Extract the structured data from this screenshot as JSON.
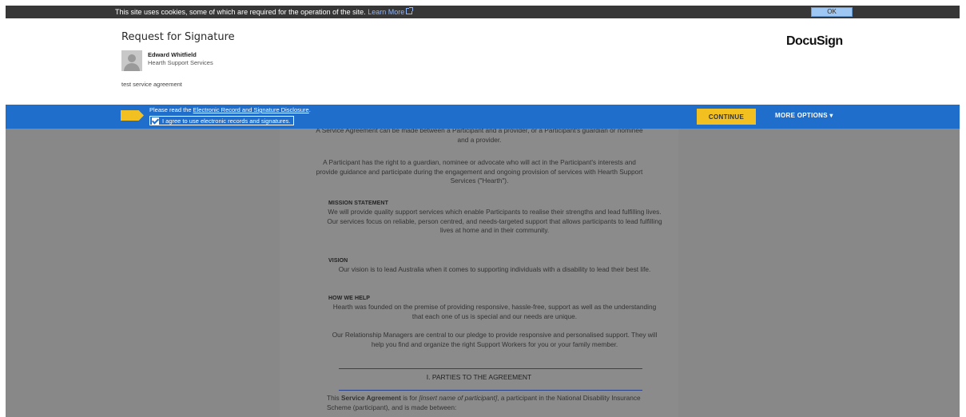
{
  "cookie_banner": {
    "text": "This site uses cookies, some of which are required for the operation of the site.",
    "link": "Learn More",
    "ok": "OK"
  },
  "header": {
    "title": "Request for Signature",
    "sender_name": "Edward Whitfield",
    "sender_company": "Hearth Support Services",
    "message": "test service agreement",
    "logo": "DocuSign"
  },
  "action_bar": {
    "read_prefix": "Please read the",
    "disclosure_link": "Electronic Record and Signature Disclosure",
    "read_suffix": ".",
    "agree_label": "I agree to use electronic records and signatures.",
    "agree_checked": true,
    "continue": "CONTINUE",
    "more_options": "MORE OPTIONS ▾"
  },
  "document": {
    "intro": "A Service Agreement can be made between a Participant and a provider, or a Participant's guardian or nominee and a provider.",
    "rights": "A Participant has the right to a guardian, nominee or advocate who will act in the Participant's interests and provide guidance and participate during the engagement and ongoing provision of services with Hearth Support Services (\"Hearth\").",
    "mission_heading": "MISSION STATEMENT",
    "mission_text": "We will provide quality support services which enable Participants to realise their strengths and lead fulfilling lives. Our services focus on reliable, person centred, and needs-targeted support that allows participants to lead fulfilling lives at home and in their community.",
    "vision_heading": "VISION",
    "vision_text": "Our vision is to lead Australia when it comes to supporting individuals with a disability to lead their best life.",
    "help_heading": "HOW WE HELP",
    "help_text": "Hearth was founded on the premise of providing responsive, hassle-free, support as well as the understanding that each one of us is special and our needs are unique.",
    "managers_text": "Our Relationship Managers are central to our pledge to provide responsive and personalised support. They will help you find and organize the right Support Workers for you or your family member.",
    "parties_heading": "I.   PARTIES TO THE AGREEMENT",
    "agreement_prefix": "This",
    "agreement_bold": "Service Agreement",
    "agreement_mid": "is for",
    "agreement_italic": "[insert name of participant]",
    "agreement_suffix": ", a participant in the National Disability Insurance Scheme (participant), and is made between:"
  }
}
